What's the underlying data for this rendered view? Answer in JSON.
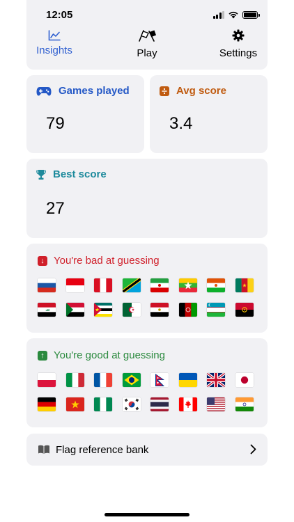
{
  "status_bar": {
    "time": "12:05"
  },
  "tabs": [
    {
      "label": "Insights",
      "icon": "chart-line-icon",
      "active": true
    },
    {
      "label": "Play",
      "icon": "flags-icon",
      "active": false
    },
    {
      "label": "Settings",
      "icon": "gear-icon",
      "active": false
    }
  ],
  "stats": {
    "games_played": {
      "label": "Games played",
      "value": "79",
      "icon": "gamepad-icon",
      "color": "#2458c6"
    },
    "avg_score": {
      "label": "Avg score",
      "value": "3.4",
      "icon": "divide-icon",
      "color": "#c05b10"
    },
    "best_score": {
      "label": "Best score",
      "value": "27",
      "icon": "trophy-icon",
      "color": "#1d8a9c"
    }
  },
  "bad_guessing": {
    "title": "You're bad at guessing",
    "icon": "arrow-down-icon",
    "flags": [
      "russia",
      "indonesia",
      "peru",
      "tanzania",
      "iran",
      "myanmar",
      "niger",
      "cameroon",
      "iraq",
      "sudan",
      "mozambique",
      "algeria",
      "egypt",
      "afghanistan",
      "uzbekistan",
      "angola"
    ]
  },
  "good_guessing": {
    "title": "You're good at guessing",
    "icon": "arrow-up-icon",
    "flags": [
      "poland",
      "italy",
      "france",
      "brazil",
      "nepal",
      "ukraine",
      "united-kingdom",
      "japan",
      "germany",
      "vietnam",
      "nigeria",
      "south-korea",
      "thailand",
      "canada",
      "united-states",
      "india"
    ]
  },
  "reference_bank": {
    "label": "Flag reference bank",
    "icon": "book-icon"
  }
}
